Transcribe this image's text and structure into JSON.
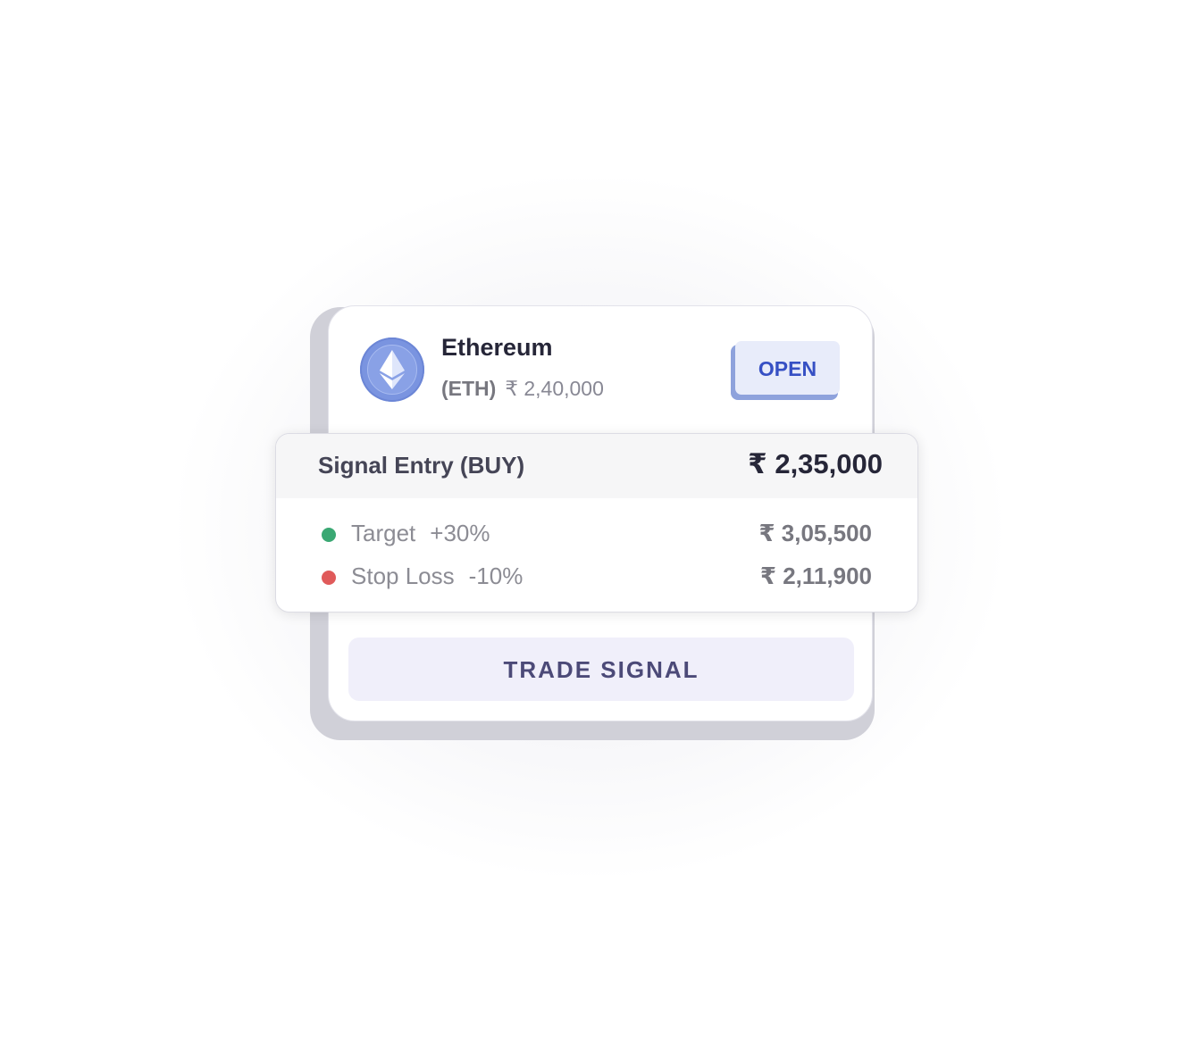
{
  "asset": {
    "name": "Ethereum",
    "symbol": "(ETH)",
    "price": "₹ 2,40,000",
    "icon": "ethereum-icon",
    "coin_color": "#7a94e0"
  },
  "status_button": {
    "label": "OPEN",
    "color": "#3650c4"
  },
  "signal": {
    "title": "Signal Entry (BUY)",
    "entry_price": "₹ 2,35,000",
    "levels": [
      {
        "label": "Target",
        "percent": "+30%",
        "value": "₹ 3,05,500",
        "dot_color": "#3aa873"
      },
      {
        "label": "Stop Loss",
        "percent": "-10%",
        "value": "₹ 2,11,900",
        "dot_color": "#e05a5a"
      }
    ]
  },
  "action_button": {
    "label": "TRADE SIGNAL"
  }
}
